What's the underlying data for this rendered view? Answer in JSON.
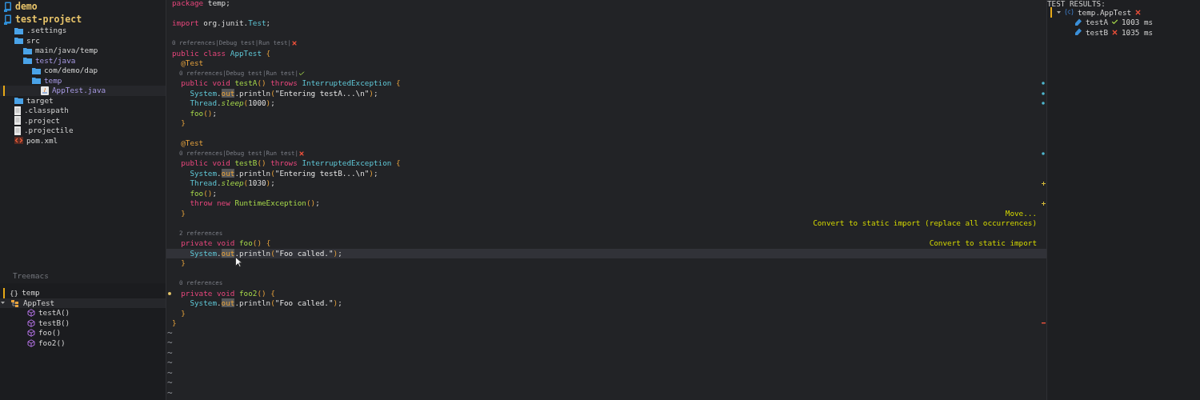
{
  "project_tree": [
    {
      "label": "demo",
      "kind": "project",
      "selected": false,
      "on_path": false
    },
    {
      "label": "test-project",
      "kind": "project",
      "selected": false,
      "on_path": false,
      "children": [
        {
          "label": ".settings",
          "kind": "folder",
          "selected": false,
          "on_path": false
        },
        {
          "label": "src",
          "kind": "folder",
          "selected": false,
          "on_path": false,
          "children": [
            {
              "label": "main/java/temp",
              "kind": "folder",
              "selected": false,
              "on_path": false
            },
            {
              "label": "test/java",
              "kind": "folder",
              "selected": false,
              "on_path": true,
              "children": [
                {
                  "label": "com/demo/dap",
                  "kind": "folder",
                  "selected": false,
                  "on_path": false
                },
                {
                  "label": "temp",
                  "kind": "folder",
                  "selected": false,
                  "on_path": true,
                  "children": [
                    {
                      "label": "AppTest.java",
                      "kind": "java",
                      "selected": true,
                      "on_path": true
                    }
                  ]
                }
              ]
            }
          ]
        },
        {
          "label": "target",
          "kind": "folder",
          "selected": false,
          "on_path": false
        },
        {
          "label": ".classpath",
          "kind": "file",
          "selected": false,
          "on_path": false
        },
        {
          "label": ".project",
          "kind": "file",
          "selected": false,
          "on_path": false
        },
        {
          "label": ".projectile",
          "kind": "file",
          "selected": false,
          "on_path": false
        },
        {
          "label": "pom.xml",
          "kind": "xml",
          "selected": false,
          "on_path": false
        }
      ]
    }
  ],
  "outline": {
    "title": "Treemacs",
    "items": [
      {
        "label": "temp",
        "kind": "package",
        "symbol": "{}",
        "selected": true
      },
      {
        "label": "AppTest",
        "kind": "class",
        "selected": false,
        "expanded": true,
        "children": [
          {
            "label": "testA()",
            "kind": "method",
            "selected": false
          },
          {
            "label": "testB()",
            "kind": "method",
            "selected": false
          },
          {
            "label": "foo()",
            "kind": "method",
            "selected": false
          },
          {
            "label": "foo2()",
            "kind": "method",
            "selected": false
          }
        ]
      }
    ]
  },
  "editor": {
    "lines": [
      {
        "kind": "code",
        "current": false,
        "text": "package temp;"
      },
      {
        "kind": "blank",
        "current": false
      },
      {
        "kind": "code",
        "current": false,
        "text": "import org.junit.Test;"
      },
      {
        "kind": "blank",
        "current": false
      },
      {
        "kind": "lens",
        "current": false,
        "text": "0 references|Debug test|Run test|",
        "passed": false
      },
      {
        "kind": "code",
        "current": false,
        "text": "public class AppTest {"
      },
      {
        "kind": "code",
        "current": false,
        "text": "  @Test"
      },
      {
        "kind": "lens",
        "current": false,
        "text": "  0 references|Debug test|Run test|",
        "passed": true
      },
      {
        "kind": "code",
        "current": false,
        "marker": {
          "kind": "info"
        },
        "text": "  public void testA() throws InterruptedException {"
      },
      {
        "kind": "code",
        "current": false,
        "marker": {
          "kind": "info"
        },
        "text": "    System.out.println(\"Entering testA...\\n\");"
      },
      {
        "kind": "code",
        "current": false,
        "marker": {
          "kind": "info"
        },
        "text": "    Thread.sleep(1000);"
      },
      {
        "kind": "code",
        "current": false,
        "text": "    foo();"
      },
      {
        "kind": "code",
        "current": false,
        "text": "  }"
      },
      {
        "kind": "blank",
        "current": false
      },
      {
        "kind": "code",
        "current": false,
        "text": "  @Test"
      },
      {
        "kind": "lens",
        "current": false,
        "marker": {
          "kind": "info"
        },
        "text": "  0 references|Debug test|Run test|",
        "passed": false
      },
      {
        "kind": "code",
        "current": false,
        "text": "  public void testB() throws InterruptedException {"
      },
      {
        "kind": "code",
        "current": false,
        "text": "    System.out.println(\"Entering testB...\\n\");"
      },
      {
        "kind": "code",
        "current": false,
        "marker": {
          "kind": "add"
        },
        "text": "    Thread.sleep(1030);"
      },
      {
        "kind": "code",
        "current": false,
        "text": "    foo();"
      },
      {
        "kind": "code",
        "current": false,
        "marker": {
          "kind": "add"
        },
        "text": "    throw new RuntimeException();"
      },
      {
        "kind": "code",
        "current": false,
        "action": "Move...",
        "text": "  }"
      },
      {
        "kind": "blank",
        "current": false,
        "action": "Convert to static import (replace all occurrences)"
      },
      {
        "kind": "lens",
        "current": false,
        "text": "  2 references"
      },
      {
        "kind": "code",
        "current": false,
        "action": "Convert to static import",
        "text": "  private void foo() {"
      },
      {
        "kind": "code",
        "current": true,
        "mouse_pointer": true,
        "text": "    System.out.println(\"Foo called.\");"
      },
      {
        "kind": "code",
        "current": false,
        "text": "  }"
      },
      {
        "kind": "blank",
        "current": false
      },
      {
        "kind": "lens",
        "current": false,
        "text": "  0 references"
      },
      {
        "kind": "code",
        "current": false,
        "warning_dot": true,
        "text": "  private void foo2() {"
      },
      {
        "kind": "code",
        "current": false,
        "text": "    System.out.println(\"Foo called.\");"
      },
      {
        "kind": "code",
        "current": false,
        "text": "  }"
      },
      {
        "kind": "code",
        "current": false,
        "marker": {
          "kind": "remove"
        },
        "text": "}"
      }
    ],
    "empty_lines": [
      "~",
      "~",
      "~",
      "~",
      "~",
      "~",
      "~"
    ]
  },
  "test_results": {
    "title": "TEST RESULTS:",
    "items": [
      {
        "label": "temp.AppTest",
        "passed": false,
        "selected": true,
        "expanded": true,
        "children": [
          {
            "label": "testA",
            "passed": true,
            "time": "1003 ms"
          },
          {
            "label": "testB",
            "passed": false,
            "time": "1035 ms"
          }
        ]
      }
    ]
  }
}
